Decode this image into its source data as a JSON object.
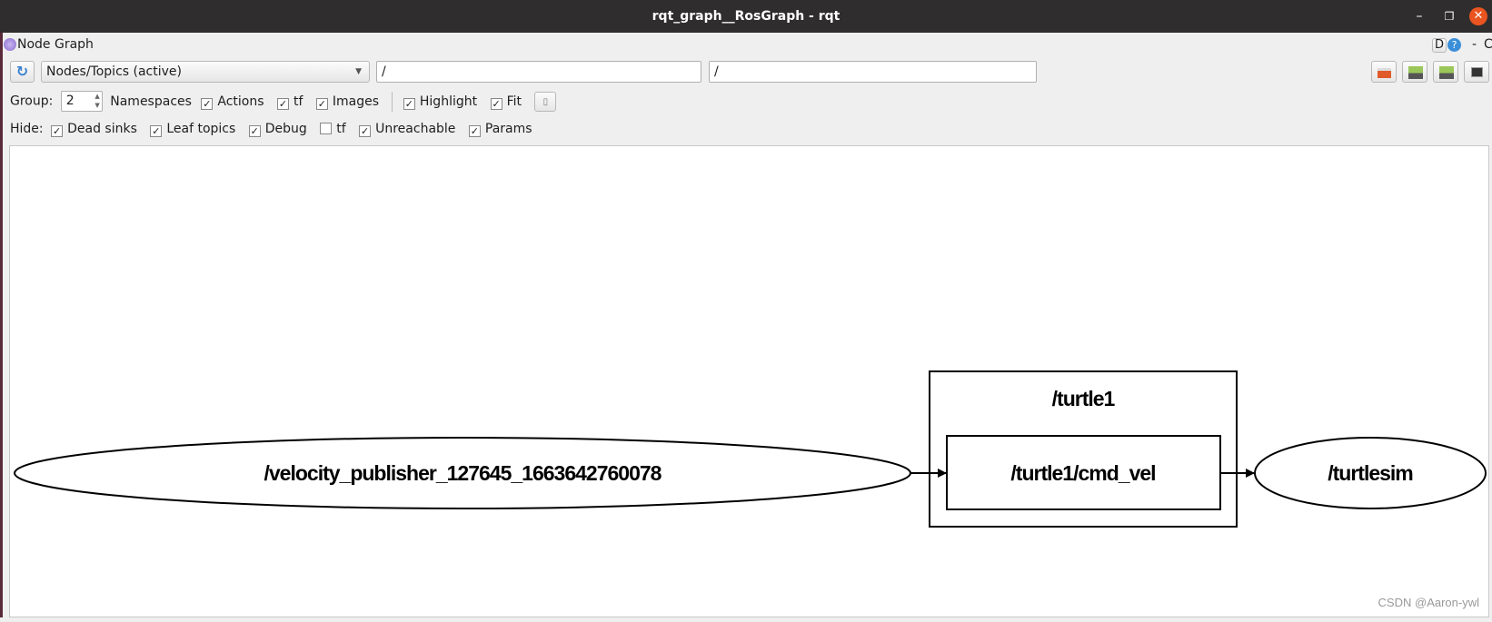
{
  "window": {
    "title": "rqt_graph__RosGraph - rqt",
    "minimize": "–",
    "restore": "❐",
    "close": "✕"
  },
  "plugin": {
    "title": "Node Graph",
    "d_label": "D",
    "help": "?",
    "dash": "-",
    "c": "C"
  },
  "toolbar": {
    "view_mode": "Nodes/Topics (active)",
    "node_filter": "/",
    "topic_filter": "/",
    "icons": [
      "refresh-icon",
      "open-folder-icon",
      "save-dot-icon",
      "save-image-icon",
      "screenshot-icon"
    ]
  },
  "options": {
    "group_label": "Group:",
    "group_value": "2",
    "items": [
      {
        "label": "Namespaces",
        "checked": null
      },
      {
        "label": "Actions",
        "checked": true
      },
      {
        "label": "tf",
        "checked": true
      },
      {
        "label": "Images",
        "checked": true
      },
      {
        "label": "Highlight",
        "checked": true
      },
      {
        "label": "Fit",
        "checked": true
      }
    ]
  },
  "hide": {
    "label": "Hide:",
    "items": [
      {
        "label": "Dead sinks",
        "checked": true
      },
      {
        "label": "Leaf topics",
        "checked": true
      },
      {
        "label": "Debug",
        "checked": true
      },
      {
        "label": "tf",
        "checked": false
      },
      {
        "label": "Unreachable",
        "checked": true
      },
      {
        "label": "Params",
        "checked": true
      }
    ]
  },
  "graph": {
    "nodes": [
      {
        "id": "velocity_publisher",
        "label": "/velocity_publisher_127645_1663642760078",
        "shape": "ellipse"
      },
      {
        "id": "turtlesim",
        "label": "/turtlesim",
        "shape": "ellipse"
      }
    ],
    "namespace": {
      "label": "/turtle1"
    },
    "topics": [
      {
        "id": "cmd_vel",
        "label": "/turtle1/cmd_vel",
        "shape": "box"
      }
    ],
    "edges": [
      {
        "from": "velocity_publisher",
        "to": "cmd_vel"
      },
      {
        "from": "cmd_vel",
        "to": "turtlesim"
      }
    ]
  },
  "watermark": "CSDN @Aaron-ywl"
}
